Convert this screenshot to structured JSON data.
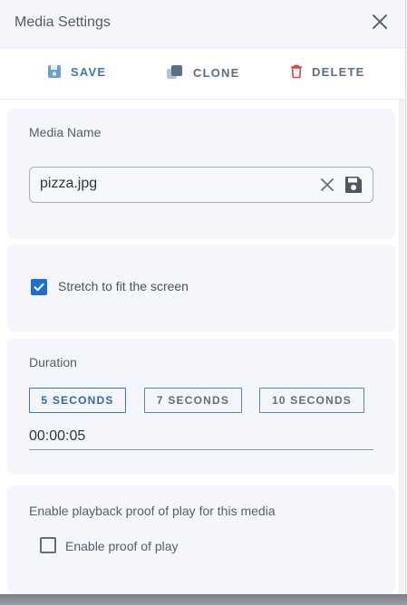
{
  "header": {
    "title": "Media Settings"
  },
  "toolbar": {
    "save_label": "SAVE",
    "clone_label": "CLONE",
    "delete_label": "DELETE",
    "icons": {
      "save": "floppy-disk-icon",
      "clone": "clone-icon",
      "delete": "trash-icon"
    }
  },
  "media_name": {
    "label": "Media Name",
    "value": "pizza.jpg"
  },
  "stretch": {
    "label": "Stretch to fit the screen",
    "checked": true
  },
  "duration": {
    "label": "Duration",
    "options": [
      "5 SECONDS",
      "7 SECONDS",
      "10 SECONDS"
    ],
    "selected": "5 SECONDS",
    "value": "00:00:05"
  },
  "proof_of_play": {
    "section_label": "Enable playback proof of play for this media",
    "checkbox_label": "Enable proof of play",
    "checked": false
  },
  "colors": {
    "accent": "#3a78b7",
    "checkbox": "#1e6fd0",
    "delete_icon": "#e04040"
  }
}
